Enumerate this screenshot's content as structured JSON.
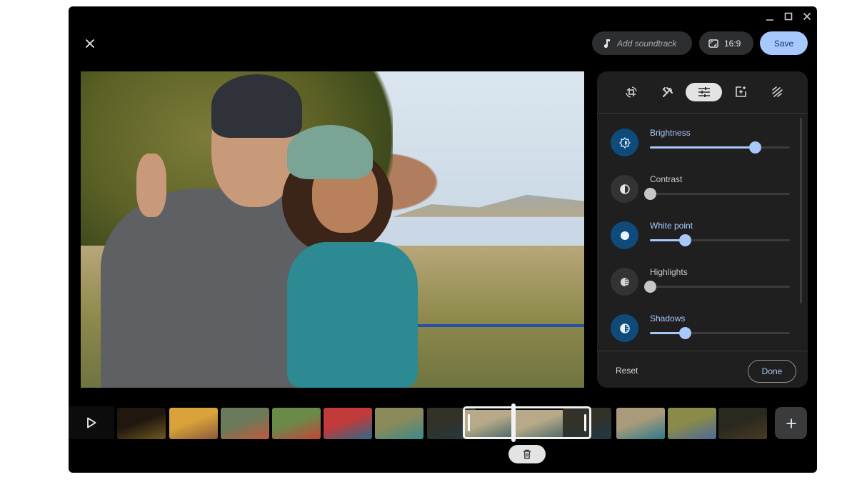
{
  "window_controls": {
    "minimize": "minimize",
    "maximize": "maximize",
    "close": "close"
  },
  "header": {
    "close_icon": "close-icon",
    "soundtrack_label": "Add soundtrack",
    "soundtrack_icon": "music-note-icon",
    "aspect_ratio_label": "16:9",
    "aspect_ratio_icon": "aspect-ratio-icon",
    "save_label": "Save"
  },
  "photo": {
    "description": "Two smiling people wearing bike helmets in a park, one making a peace sign"
  },
  "panel": {
    "tabs": [
      {
        "name": "crop-rotate",
        "icon": "crop-rotate-icon",
        "active": false
      },
      {
        "name": "tools",
        "icon": "tools-icon",
        "active": false
      },
      {
        "name": "adjust",
        "icon": "sliders-icon",
        "active": true
      },
      {
        "name": "filters",
        "icon": "add-photo-icon",
        "active": false
      },
      {
        "name": "markup",
        "icon": "draw-icon",
        "active": false
      }
    ],
    "adjustments": [
      {
        "label": "Brightness",
        "icon": "brightness-icon",
        "active": true,
        "value_fraction": 0.75
      },
      {
        "label": "Contrast",
        "icon": "contrast-icon",
        "active": false,
        "value_fraction": 0.0
      },
      {
        "label": "White point",
        "icon": "white-point-icon",
        "active": true,
        "value_fraction": 0.25
      },
      {
        "label": "Highlights",
        "icon": "highlights-icon",
        "active": false,
        "value_fraction": 0.0
      },
      {
        "label": "Shadows",
        "icon": "shadows-icon",
        "active": true,
        "value_fraction": 0.25
      }
    ],
    "reset_label": "Reset",
    "done_label": "Done"
  },
  "timeline": {
    "play_icon": "play-icon",
    "add_icon": "plus-icon",
    "delete_icon": "trash-icon",
    "thumbnail_colors": [
      [
        "#3a2a1a",
        "#c9a13a"
      ],
      [
        "#d9a23a",
        "#8a5a3a"
      ],
      [
        "#6a7a5a",
        "#c25a3a"
      ],
      [
        "#6a8a4a",
        "#c4443a"
      ],
      [
        "#c23a3a",
        "#2a6a8a"
      ],
      [
        "#8a8a5a",
        "#3a8a8a"
      ],
      [
        "#5a5a4a",
        "#3a6a7a"
      ],
      [
        "#b8aa88",
        "#4a6a6a"
      ],
      [
        "#b8aa88",
        "#4a6a6a"
      ],
      [
        "#5a5a4a",
        "#3a6a7a"
      ],
      [
        "#a89a7a",
        "#2a7a8a"
      ],
      [
        "#8a8a4a",
        "#4a6a9a"
      ],
      [
        "#4a4a3a",
        "#8a6a3a"
      ]
    ]
  }
}
